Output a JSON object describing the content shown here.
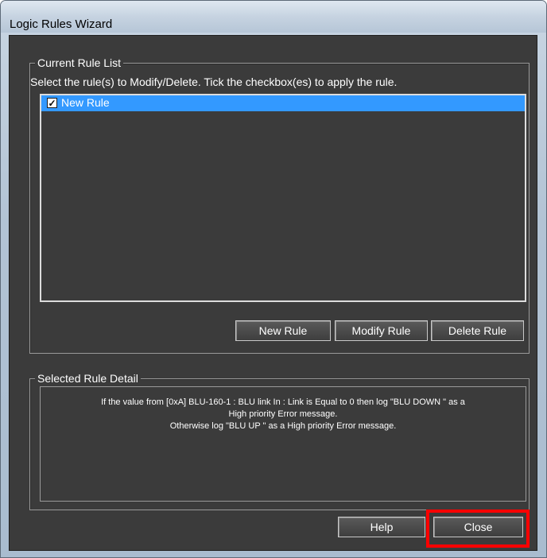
{
  "window": {
    "title": "Logic Rules Wizard"
  },
  "rule_list_group": {
    "legend": "Current Rule List",
    "instruction": "Select the rule(s) to Modify/Delete. Tick the checkbox(es) to apply the rule.",
    "rules": [
      {
        "label": "New Rule",
        "checked": true,
        "selected": true
      }
    ],
    "buttons": {
      "new": "New Rule",
      "modify": "Modify Rule",
      "delete": "Delete Rule"
    }
  },
  "detail_group": {
    "legend": "Selected Rule Detail",
    "lines": [
      "If the value from [0xA] BLU-160-1 : BLU link In : Link  is  Equal to 0  then  log \"BLU DOWN \" as a",
      "High  priority  Error message.",
      "Otherwise log \"BLU UP \" as a  High  priority  Error  message."
    ]
  },
  "footer": {
    "help": "Help",
    "close": "Close"
  },
  "colors": {
    "selection": "#3399ff",
    "highlight_box": "#ff0000",
    "panel": "#3b3b3b"
  }
}
